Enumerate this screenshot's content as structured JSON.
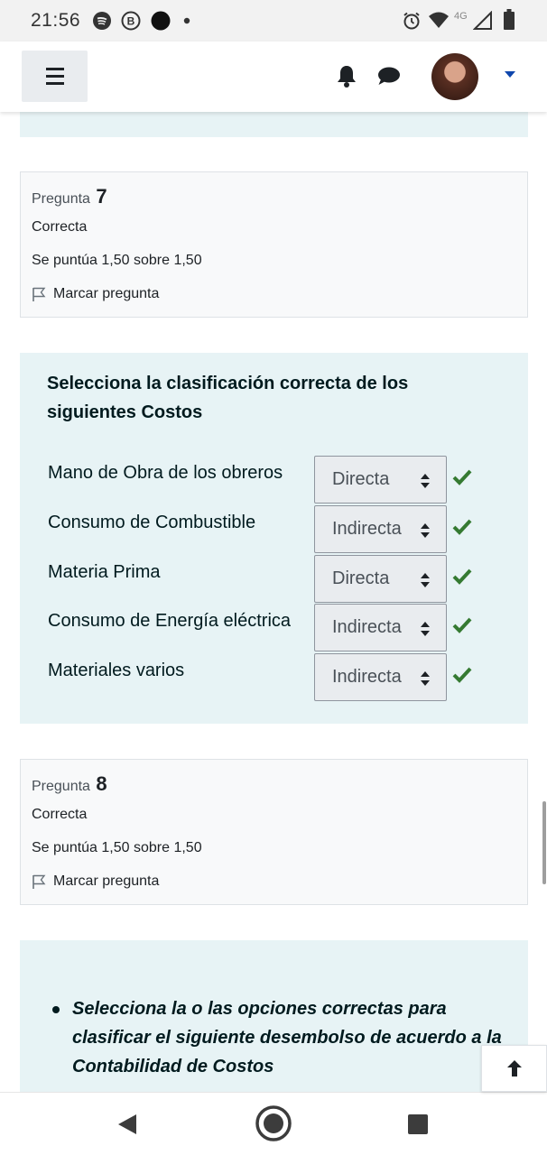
{
  "status_bar": {
    "time": "21:56",
    "network": "4G",
    "icons": [
      "spotify-icon",
      "b-badge-icon",
      "circle-icon",
      "dot-icon",
      "alarm-icon",
      "wifi-icon",
      "signal-icon",
      "battery-icon"
    ]
  },
  "navbar": {
    "icons": [
      "menu-icon",
      "bell-icon",
      "chat-icon",
      "avatar",
      "caret-down-icon"
    ],
    "accent_color": "#0f47ad"
  },
  "question7": {
    "label": "Pregunta",
    "number": "7",
    "state": "Correcta",
    "grade": "Se puntúa 1,50 sobre 1,50",
    "flag_label": "Marcar pregunta",
    "prompt": "Selecciona la clasificación correcta de los siguientes Costos",
    "rows": [
      {
        "label": "Mano de Obra de los obreros",
        "selected": "Directa",
        "correct": true
      },
      {
        "label": "Consumo de Combustible",
        "selected": "Indirecta",
        "correct": true
      },
      {
        "label": "Materia Prima",
        "selected": "Directa",
        "correct": true
      },
      {
        "label": "Consumo de Energía eléctrica",
        "selected": "Indirecta",
        "correct": true
      },
      {
        "label": "Materiales varios",
        "selected": "Indirecta",
        "correct": true
      }
    ]
  },
  "question8": {
    "label": "Pregunta",
    "number": "8",
    "state": "Correcta",
    "grade": "Se puntúa 1,50 sobre 1,50",
    "flag_label": "Marcar pregunta",
    "prompt": "Selecciona la o las opciones correctas para clasificar el siguiente desembolso de acuerdo a la Contabilidad de Costos"
  },
  "colors": {
    "panel_bg": "#e7f3f5",
    "check_green": "#357a32",
    "info_bg": "#f8f9fa"
  },
  "android_nav": {
    "icons": [
      "back-icon",
      "home-icon",
      "recents-icon"
    ]
  }
}
